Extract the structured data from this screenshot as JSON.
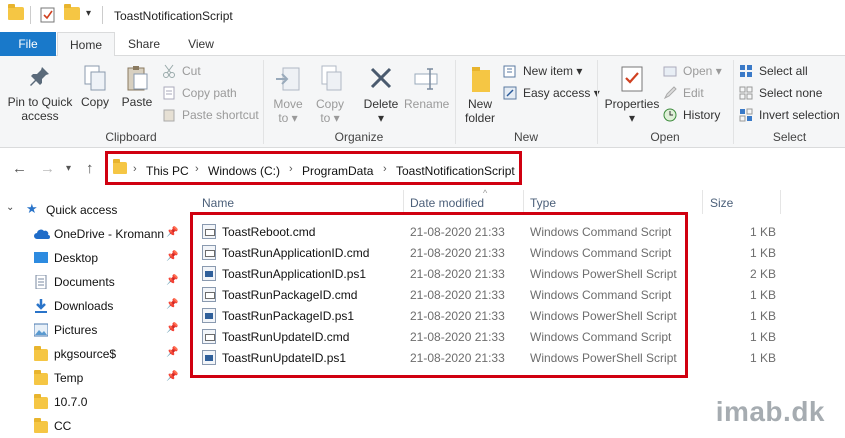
{
  "window": {
    "title": "ToastNotificationScript"
  },
  "tabs": [
    {
      "label": "File"
    },
    {
      "label": "Home"
    },
    {
      "label": "Share"
    },
    {
      "label": "View"
    }
  ],
  "ribbon": {
    "clipboard": {
      "label": "Clipboard",
      "pin_label_1": "Pin to Quick",
      "pin_label_2": "access",
      "copy": "Copy",
      "paste": "Paste",
      "cut": "Cut",
      "copy_path": "Copy path",
      "paste_shortcut": "Paste shortcut"
    },
    "organize": {
      "label": "Organize",
      "move_to_1": "Move",
      "move_to_2": "to",
      "copy_to_1": "Copy",
      "copy_to_2": "to",
      "delete": "Delete",
      "rename": "Rename"
    },
    "new": {
      "label": "New",
      "new_folder_1": "New",
      "new_folder_2": "folder",
      "new_item": "New item",
      "easy_access": "Easy access"
    },
    "open": {
      "label": "Open",
      "properties": "Properties",
      "open": "Open",
      "edit": "Edit",
      "history": "History"
    },
    "select": {
      "label": "Select",
      "select_all": "Select all",
      "select_none": "Select none",
      "invert_selection": "Invert selection"
    }
  },
  "address": {
    "crumbs": [
      "This PC",
      "Windows (C:)",
      "ProgramData",
      "ToastNotificationScript"
    ]
  },
  "nav": {
    "quick_access": "Quick access",
    "items": [
      {
        "label": "OneDrive - Kromann",
        "pinned": true
      },
      {
        "label": "Desktop",
        "pinned": true
      },
      {
        "label": "Documents",
        "pinned": true
      },
      {
        "label": "Downloads",
        "pinned": true
      },
      {
        "label": "Pictures",
        "pinned": true
      },
      {
        "label": "pkgsource$",
        "pinned": true
      },
      {
        "label": "Temp",
        "pinned": true
      },
      {
        "label": "10.7.0",
        "pinned": false
      },
      {
        "label": "CC",
        "pinned": false
      }
    ]
  },
  "columns": {
    "name": "Name",
    "date": "Date modified",
    "type": "Type",
    "size": "Size"
  },
  "files": [
    {
      "name": "ToastReboot.cmd",
      "date": "21-08-2020 21:33",
      "type": "Windows Command Script",
      "size": "1 KB",
      "icon": "cmd"
    },
    {
      "name": "ToastRunApplicationID.cmd",
      "date": "21-08-2020 21:33",
      "type": "Windows Command Script",
      "size": "1 KB",
      "icon": "cmd"
    },
    {
      "name": "ToastRunApplicationID.ps1",
      "date": "21-08-2020 21:33",
      "type": "Windows PowerShell Script",
      "size": "2 KB",
      "icon": "ps"
    },
    {
      "name": "ToastRunPackageID.cmd",
      "date": "21-08-2020 21:33",
      "type": "Windows Command Script",
      "size": "1 KB",
      "icon": "cmd"
    },
    {
      "name": "ToastRunPackageID.ps1",
      "date": "21-08-2020 21:33",
      "type": "Windows PowerShell Script",
      "size": "1 KB",
      "icon": "ps"
    },
    {
      "name": "ToastRunUpdateID.cmd",
      "date": "21-08-2020 21:33",
      "type": "Windows Command Script",
      "size": "1 KB",
      "icon": "cmd"
    },
    {
      "name": "ToastRunUpdateID.ps1",
      "date": "21-08-2020 21:33",
      "type": "Windows PowerShell Script",
      "size": "1 KB",
      "icon": "ps"
    }
  ],
  "watermark": "imab.dk",
  "colors": {
    "accent": "#1979ca",
    "highlight_box": "#d00010",
    "folder": "#f5c644"
  }
}
